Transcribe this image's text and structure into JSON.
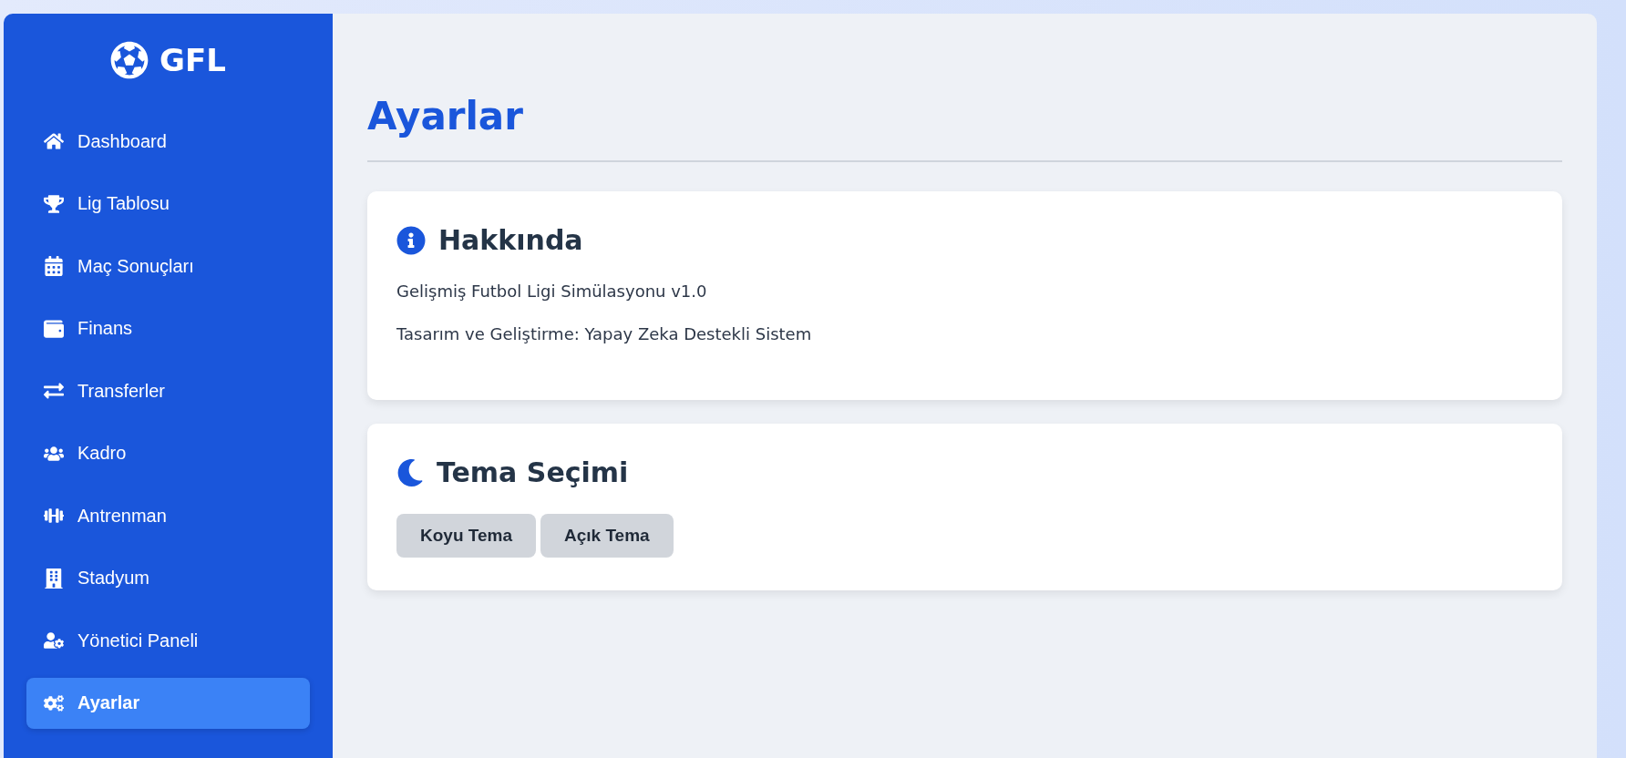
{
  "brand": {
    "title": "GFL"
  },
  "sidebar": {
    "items": [
      {
        "label": "Dashboard",
        "selected": false
      },
      {
        "label": "Lig Tablosu",
        "selected": false
      },
      {
        "label": "Maç Sonuçları",
        "selected": false
      },
      {
        "label": "Finans",
        "selected": false
      },
      {
        "label": "Transferler",
        "selected": false
      },
      {
        "label": "Kadro",
        "selected": false
      },
      {
        "label": "Antrenman",
        "selected": false
      },
      {
        "label": "Stadyum",
        "selected": false
      },
      {
        "label": "Yönetici Paneli",
        "selected": false
      },
      {
        "label": "Ayarlar",
        "selected": true
      }
    ]
  },
  "page": {
    "title": "Ayarlar"
  },
  "about": {
    "title": "Hakkında",
    "lines": [
      "Gelişmiş Futbol Ligi Simülasyonu v1.0",
      "Tasarım ve Geliştirme: Yapay Zeka Destekli Sistem"
    ]
  },
  "theme": {
    "title": "Tema Seçimi",
    "buttons": [
      "Koyu Tema",
      "Açık Tema"
    ]
  }
}
